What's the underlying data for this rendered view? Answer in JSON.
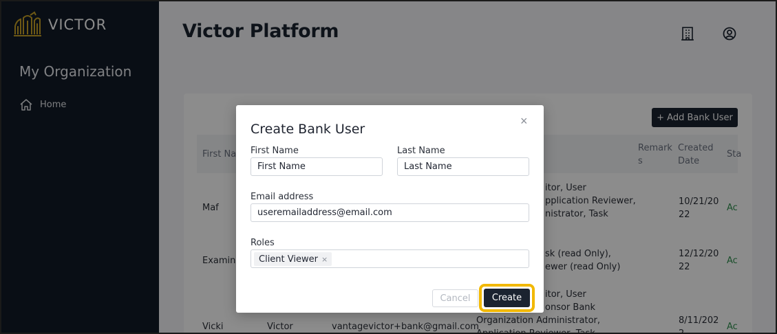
{
  "sidebar": {
    "logo_text": "VICTOR",
    "org_title": "My Organization",
    "nav": [
      {
        "label": "Home",
        "icon": "home-icon"
      }
    ]
  },
  "header": {
    "title": "Victor Platform",
    "icons": [
      "building-icon",
      "user-circle-icon"
    ]
  },
  "page": {
    "add_button": "+ Add Bank User",
    "table": {
      "headers": {
        "first_name": "First Nar",
        "remarks_1": "Remark",
        "remarks_2": "s",
        "created_1": "Created",
        "created_2": "Date",
        "status": "Sta"
      },
      "rows": [
        {
          "first": "Maf",
          "roles": [
            "itor, User",
            "pplication Reviewer,",
            "nistrator, Task"
          ],
          "date": [
            "10/21/20",
            "22"
          ],
          "status": "Ac"
        },
        {
          "first": "Examine",
          "roles": [
            "sk (read Only),",
            "ewer (read Only)"
          ],
          "date": [
            "12/12/20",
            "22"
          ],
          "status": "Ac"
        },
        {
          "first": "Vicki",
          "last": "Victor",
          "email": "vantagevictor+bank@gmail.com",
          "roles": [
            "itor, User",
            "onsor Bank",
            "Organization Administrator,",
            "Application Reviewer, Task"
          ],
          "date": [
            "8/11/202",
            "2"
          ],
          "status": "Ac"
        }
      ]
    }
  },
  "modal": {
    "title": "Create Bank User",
    "close_glyph": "×",
    "first_name": {
      "label": "First Name",
      "placeholder": "First Name"
    },
    "last_name": {
      "label": "Last Name",
      "placeholder": "Last Name"
    },
    "email": {
      "label": "Email address",
      "placeholder": "useremailaddress@email.com"
    },
    "roles": {
      "label": "Roles",
      "selected": [
        "Client Viewer"
      ],
      "remove_glyph": "×"
    },
    "cancel_label": "Cancel",
    "create_label": "Create"
  },
  "colors": {
    "sidebar_bg": "#111b27",
    "primary_button": "#1b2330",
    "highlight": "#f2b800",
    "logo_gold": "#c9a227",
    "status_green": "#2f8f4e"
  }
}
